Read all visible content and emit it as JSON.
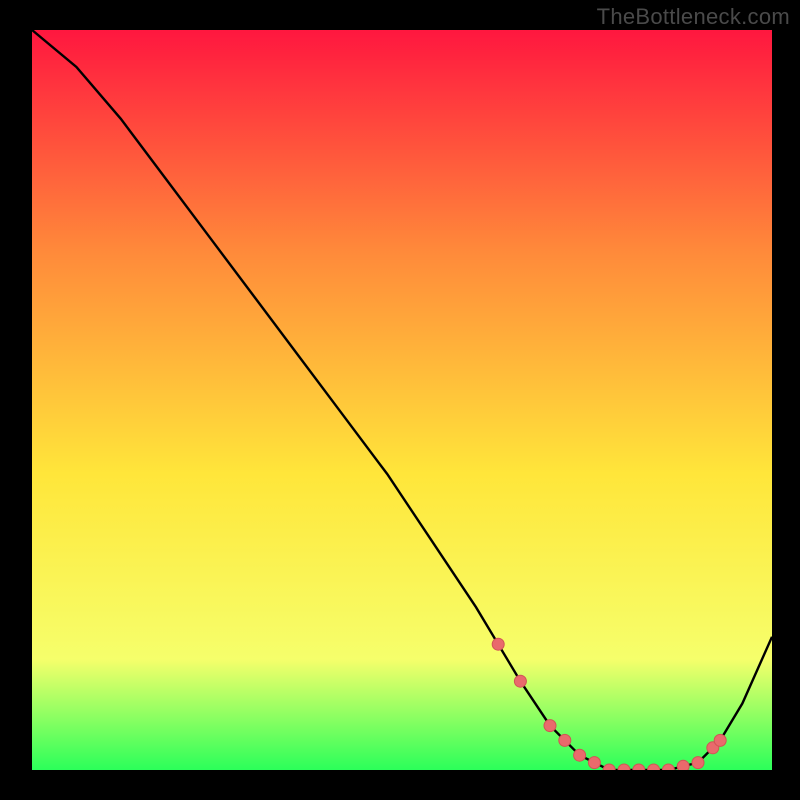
{
  "watermark": "TheBottleneck.com",
  "colors": {
    "bg": "#000000",
    "grad_top": "#ff173f",
    "grad_mid1": "#ff8a3a",
    "grad_mid2": "#ffe63a",
    "grad_mid3": "#f6ff6b",
    "grad_bottom": "#2bff5a",
    "line": "#000000",
    "marker_fill": "#e96a6c",
    "marker_stroke": "#d15555"
  },
  "chart_data": {
    "type": "line",
    "title": "",
    "xlabel": "",
    "ylabel": "",
    "xlim": [
      0,
      100
    ],
    "ylim": [
      0,
      100
    ],
    "series": [
      {
        "name": "curve",
        "x": [
          0,
          6,
          12,
          18,
          24,
          30,
          36,
          42,
          48,
          54,
          60,
          63,
          66,
          70,
          74,
          78,
          82,
          86,
          90,
          93,
          96,
          100
        ],
        "y": [
          100,
          95,
          88,
          80,
          72,
          64,
          56,
          48,
          40,
          31,
          22,
          17,
          12,
          6,
          2,
          0,
          0,
          0,
          1,
          4,
          9,
          18
        ]
      }
    ],
    "markers": {
      "name": "highlighted-points",
      "x": [
        63,
        66,
        70,
        72,
        74,
        76,
        78,
        80,
        82,
        84,
        86,
        88,
        90,
        92,
        93
      ],
      "y": [
        17,
        12,
        6,
        4,
        2,
        1,
        0,
        0,
        0,
        0,
        0,
        0.5,
        1,
        3,
        4
      ]
    }
  }
}
